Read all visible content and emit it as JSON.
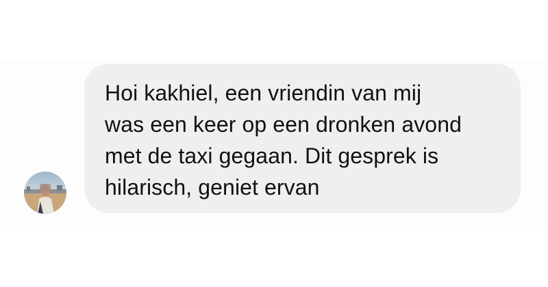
{
  "conversation": {
    "incoming_message": {
      "lines": [
        "Hoi kakhiel, een vriendin van mij",
        "was een keer op een dronken avond",
        "met de taxi gegaan. Dit gesprek is",
        "hilarisch, geniet ervan"
      ],
      "bubble_color": "#efefef",
      "text_color": "#111111"
    },
    "sender": {
      "avatar_icon": "profile-photo-icon"
    }
  }
}
